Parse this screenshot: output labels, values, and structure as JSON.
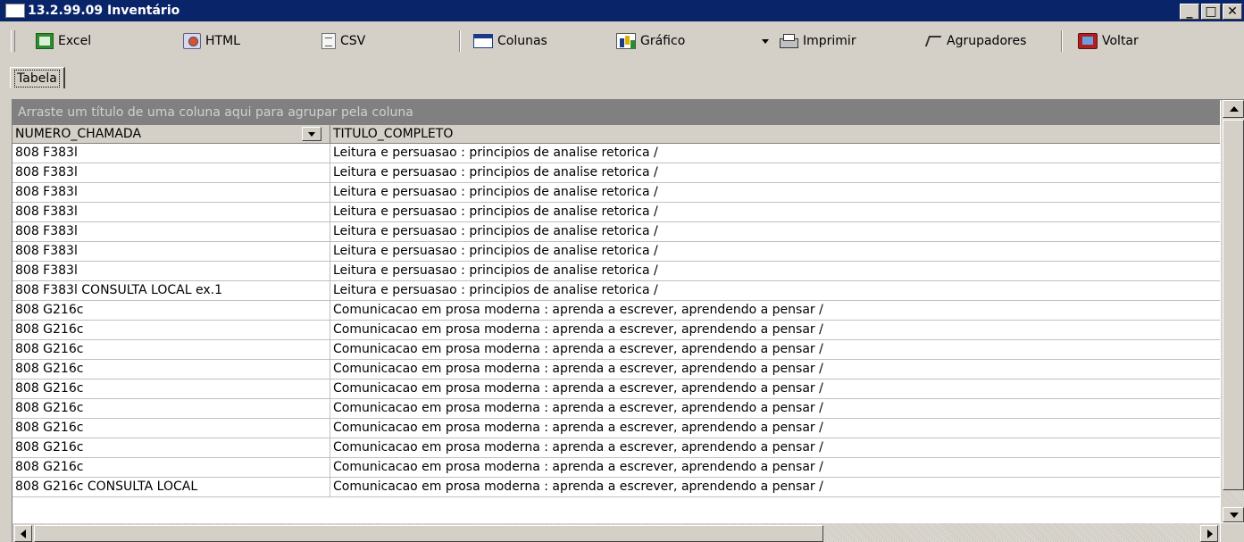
{
  "window": {
    "title": "13.2.99.09 Inventário",
    "minimize": "_",
    "maximize": "□",
    "close": "✕"
  },
  "toolbar": {
    "excel": "Excel",
    "html": "HTML",
    "csv": "CSV",
    "colunas": "Colunas",
    "grafico": "Gráfico",
    "imprimir": "Imprimir",
    "agrupadores": "Agrupadores",
    "voltar": "Voltar"
  },
  "tabs": [
    {
      "label": "Tabela"
    }
  ],
  "grid": {
    "group_hint": "Arraste um título de uma coluna aqui para agrupar pela coluna",
    "columns": [
      "NUMERO_CHAMADA",
      "TITULO_COMPLETO"
    ],
    "rows": [
      [
        "808 F383l",
        "Leitura e persuasao : principios de analise retorica /"
      ],
      [
        "808 F383l",
        "Leitura e persuasao : principios de analise retorica /"
      ],
      [
        "808 F383l",
        "Leitura e persuasao : principios de analise retorica /"
      ],
      [
        "808 F383l",
        "Leitura e persuasao : principios de analise retorica /"
      ],
      [
        "808 F383l",
        "Leitura e persuasao : principios de analise retorica /"
      ],
      [
        "808 F383l",
        "Leitura e persuasao : principios de analise retorica /"
      ],
      [
        "808 F383l",
        "Leitura e persuasao : principios de analise retorica /"
      ],
      [
        "808 F383l CONSULTA LOCAL ex.1",
        "Leitura e persuasao : principios de analise retorica /"
      ],
      [
        "808 G216c",
        "Comunicacao em prosa moderna : aprenda a escrever, aprendendo a pensar /"
      ],
      [
        "808 G216c",
        "Comunicacao em prosa moderna : aprenda a escrever, aprendendo a pensar /"
      ],
      [
        "808 G216c",
        "Comunicacao em prosa moderna : aprenda a escrever, aprendendo a pensar /"
      ],
      [
        "808 G216c",
        "Comunicacao em prosa moderna : aprenda a escrever, aprendendo a pensar /"
      ],
      [
        "808 G216c",
        "Comunicacao em prosa moderna : aprenda a escrever, aprendendo a pensar /"
      ],
      [
        "808 G216c",
        "Comunicacao em prosa moderna : aprenda a escrever, aprendendo a pensar /"
      ],
      [
        "808 G216c",
        "Comunicacao em prosa moderna : aprenda a escrever, aprendendo a pensar /"
      ],
      [
        "808 G216c",
        "Comunicacao em prosa moderna : aprenda a escrever, aprendendo a pensar /"
      ],
      [
        "808 G216c",
        "Comunicacao em prosa moderna : aprenda a escrever, aprendendo a pensar /"
      ],
      [
        "808 G216c CONSULTA LOCAL",
        "Comunicacao em prosa moderna : aprenda a escrever, aprendendo a pensar /"
      ]
    ]
  },
  "colors": {
    "titlebar": "#0a246a",
    "face": "#d4d0c8",
    "groupbar": "#808080"
  }
}
